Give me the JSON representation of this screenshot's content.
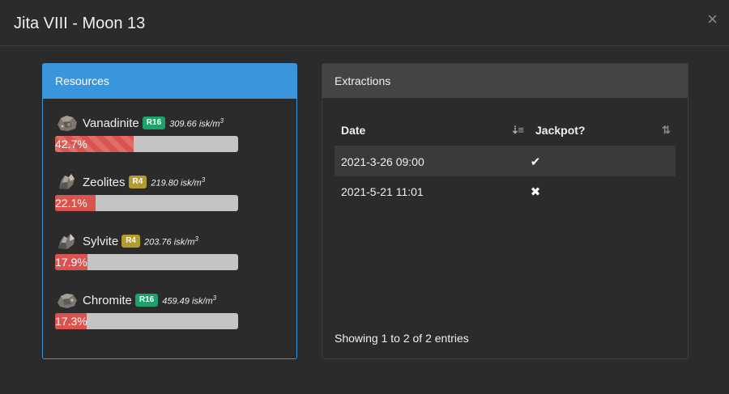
{
  "modal": {
    "title": "Jita VIII - Moon 13",
    "close_label": "×"
  },
  "resources": {
    "header": "Resources",
    "items": [
      {
        "name": "Vanadinite",
        "tier": "R16",
        "tier_color": "#1aa36a",
        "price_value": "309.66",
        "price_unit": "isk/m",
        "price_exp": "3",
        "percent_label": "42.7%",
        "percent": 42.7
      },
      {
        "name": "Zeolites",
        "tier": "R4",
        "tier_color": "#b39b2e",
        "price_value": "219.80",
        "price_unit": "isk/m",
        "price_exp": "3",
        "percent_label": "22.1%",
        "percent": 22.1
      },
      {
        "name": "Sylvite",
        "tier": "R4",
        "tier_color": "#b39b2e",
        "price_value": "203.76",
        "price_unit": "isk/m",
        "price_exp": "3",
        "percent_label": "17.9%",
        "percent": 17.9
      },
      {
        "name": "Chromite",
        "tier": "R16",
        "tier_color": "#1aa36a",
        "price_value": "459.49",
        "price_unit": "isk/m",
        "price_exp": "3",
        "percent_label": "17.3%",
        "percent": 17.3
      }
    ]
  },
  "extractions": {
    "header": "Extractions",
    "columns": {
      "date": "Date",
      "jackpot": "Jackpot?"
    },
    "rows": [
      {
        "date": "2021-3-26 09:00",
        "jackpot": "check-icon"
      },
      {
        "date": "2021-5-21 11:01",
        "jackpot": "times-icon"
      }
    ],
    "info": "Showing 1 to 2 of 2 entries"
  },
  "colors": {
    "accent": "#3a96dc",
    "bar_fill": "#d9534f",
    "bar_track": "#c4c4c4",
    "background": "#2b2b2b"
  }
}
